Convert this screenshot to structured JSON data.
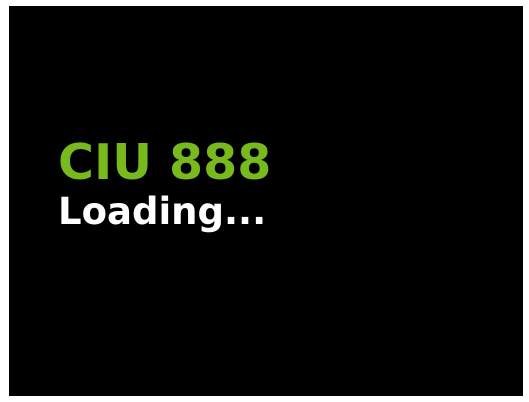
{
  "splash": {
    "title": "CIU 888",
    "status": "Loading..."
  },
  "colors": {
    "background": "#000000",
    "title": "#78b91e",
    "status": "#ffffff"
  }
}
